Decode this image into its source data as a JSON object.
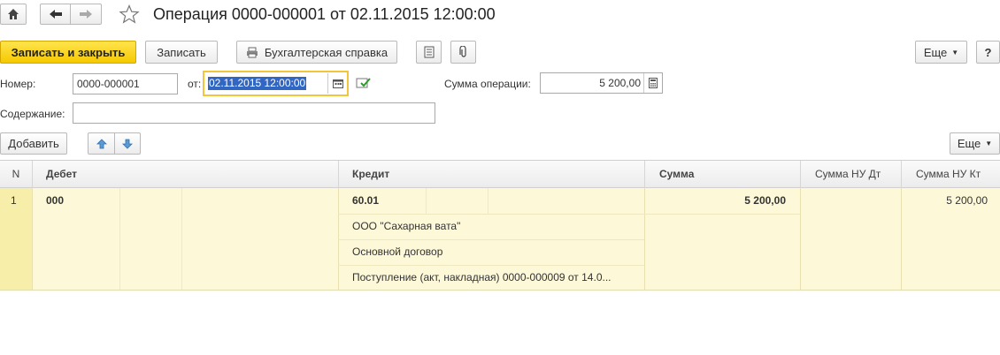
{
  "window": {
    "title": "Операция 0000-000001 от 02.11.2015 12:00:00"
  },
  "nav": {
    "home_icon": "home-icon",
    "back_icon": "arrow-left-icon",
    "forward_icon": "arrow-right-icon",
    "favorite_icon": "star-icon"
  },
  "toolbar": {
    "save_close_label": "Записать и закрыть",
    "save_label": "Записать",
    "report_label": "Бухгалтерская справка",
    "more_label": "Еще",
    "help_label": "?"
  },
  "form": {
    "number_label": "Номер:",
    "number_value": "0000-000001",
    "date_label": "от:",
    "date_value": "02.11.2015 12:00:00",
    "sum_label": "Сумма операции:",
    "sum_value": "5 200,00",
    "content_label": "Содержание:",
    "content_value": ""
  },
  "table_toolbar": {
    "add_label": "Добавить",
    "more_label": "Еще"
  },
  "table": {
    "headers": {
      "n": "N",
      "debit": "Дебет",
      "credit": "Кредит",
      "sum": "Сумма",
      "sum_nu_dt": "Сумма НУ Дт",
      "sum_nu_kt": "Сумма НУ Кт"
    },
    "rows": [
      {
        "n": "1",
        "debit_account": "000",
        "credit_account": "60.01",
        "credit_subconto1": "ООО \"Сахарная вата\"",
        "credit_subconto2": "Основной договор",
        "credit_subconto3": "Поступление (акт, накладная) 0000-000009 от 14.0...",
        "sum": "5 200,00",
        "sum_nu_dt": "",
        "sum_nu_kt": "5 200,00"
      }
    ]
  }
}
